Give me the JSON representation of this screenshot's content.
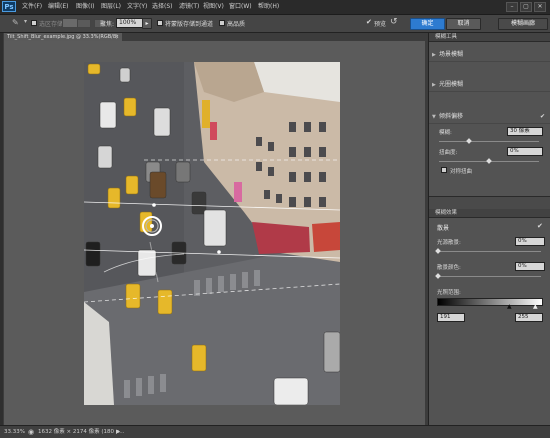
{
  "app": {
    "logo": "Ps"
  },
  "menu": [
    "文件(F)",
    "编辑(E)",
    "图像(I)",
    "图层(L)",
    "文字(Y)",
    "选择(S)",
    "滤镜(T)",
    "视图(V)",
    "窗口(W)",
    "帮助(H)"
  ],
  "window_controls": [
    "–",
    "▢",
    "✕"
  ],
  "options": {
    "selection_label": "选区存储",
    "selection_value": "",
    "focus_label": "聚焦:",
    "focus_value": "100%",
    "save_mask_label": "将蒙版存储到通道",
    "high_quality_label": "高品质",
    "preview_label": "预览",
    "ok_label": "确定",
    "cancel_label": "取消",
    "workspace_value": "模糊画廊"
  },
  "document_tab": "Tilt_Shift_Blur_example.jpg @ 33.3%(RGB/8)",
  "status": {
    "zoom": "33.33%",
    "doc_info": "1632 像素 × 2174 像素 (180 p...",
    "arrow": "▶"
  },
  "blur_tools": {
    "header": "模糊工具",
    "field_blur": "场景模糊",
    "iris_blur": "光圈模糊",
    "tilt_shift": "倾斜偏移",
    "blur_label": "模糊:",
    "blur_value": "30 像素",
    "distortion_label": "扭曲度:",
    "distortion_value": "0%",
    "symmetric_label": "对称扭曲"
  },
  "blur_effects": {
    "header": "模糊效果",
    "bokeh_label": "散景",
    "light_bokeh_label": "光源散景:",
    "light_bokeh_value": "0%",
    "bokeh_color_label": "散景颜色:",
    "bokeh_color_value": "0%",
    "light_range_label": "光照范围:",
    "range_low": "191",
    "range_high": "255"
  },
  "colors": {
    "accent": "#2d7bd0",
    "taxi": "#e6b82a",
    "awning": "#b03a48"
  }
}
